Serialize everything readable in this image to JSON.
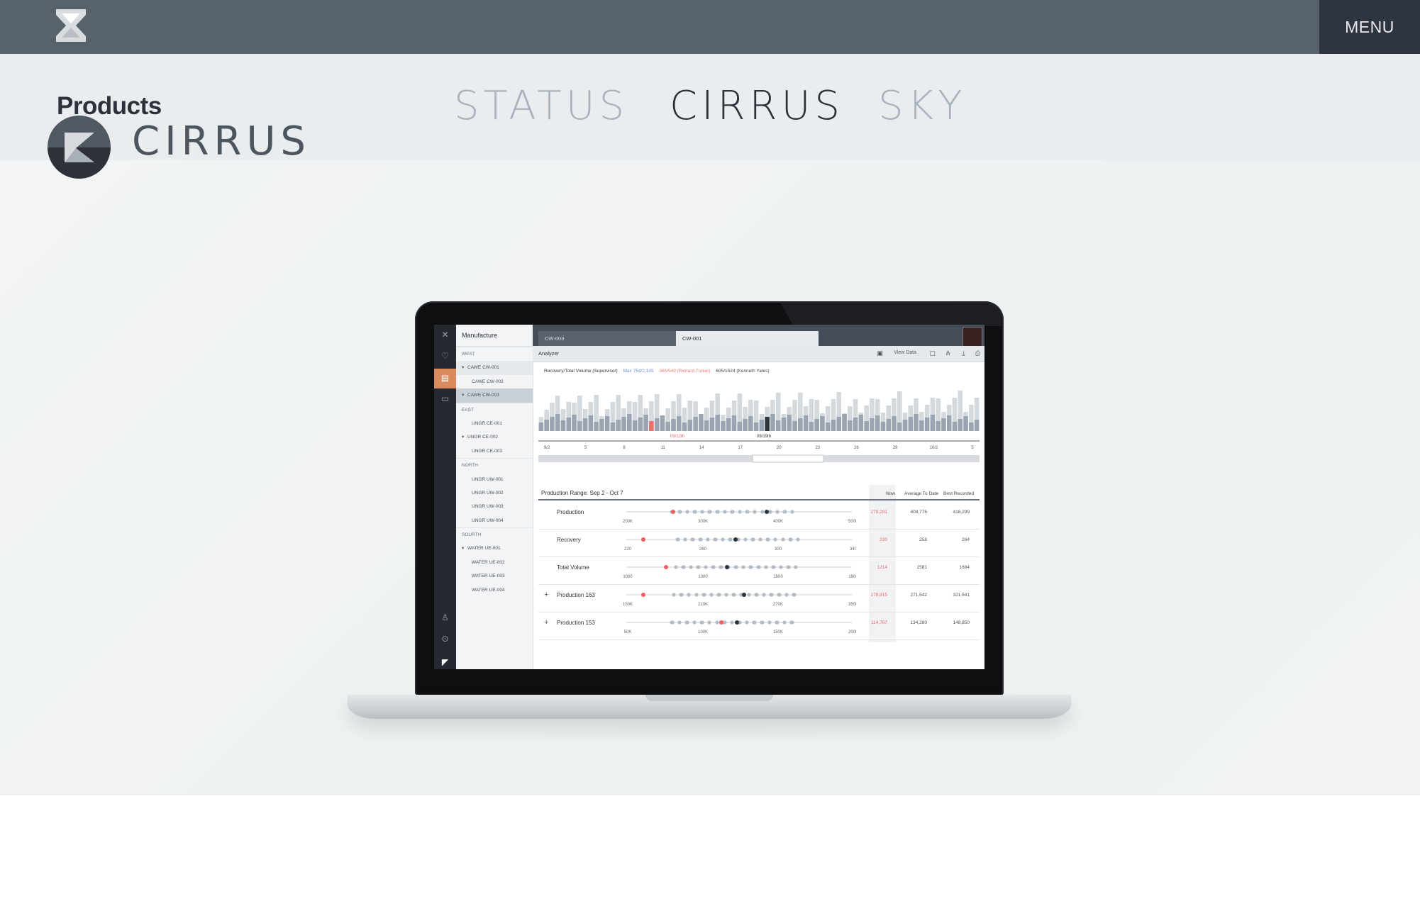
{
  "header": {
    "menu_label": "MENU",
    "logo_icon": "hourglass-logo-icon"
  },
  "nav": {
    "title": "Products",
    "tabs": [
      {
        "label": "STATUS",
        "active": false
      },
      {
        "label": "CIRRUS",
        "active": true
      },
      {
        "label": "SKY",
        "active": false
      }
    ]
  },
  "hero": {
    "brand_name": "CIRRUS",
    "brand_icon": "cirrus-k-badge-icon"
  },
  "app": {
    "sidebar_title": "Manufacture",
    "tree": [
      {
        "label": "WEST",
        "type": "group"
      },
      {
        "label": "CAWE CW-001",
        "type": "node",
        "state": "hl"
      },
      {
        "label": "CAWE CW-002",
        "type": "leaf"
      },
      {
        "label": "CAWE CW-003",
        "type": "node",
        "state": "sel"
      },
      {
        "label": "EAST",
        "type": "group"
      },
      {
        "label": "UNGR CE-001",
        "type": "leaf"
      },
      {
        "label": "UNGR CE-002",
        "type": "node"
      },
      {
        "label": "UNGR CE-003",
        "type": "leaf"
      },
      {
        "label": "NORTH",
        "type": "group"
      },
      {
        "label": "UNGR UW-001",
        "type": "leaf"
      },
      {
        "label": "UNGR UW-002",
        "type": "leaf"
      },
      {
        "label": "UNGR UW-003",
        "type": "leaf"
      },
      {
        "label": "UNGR UW-004",
        "type": "leaf"
      },
      {
        "label": "SOURTH",
        "type": "group"
      },
      {
        "label": "WATER UE-001",
        "type": "node"
      },
      {
        "label": "WATER UE-002",
        "type": "leaf"
      },
      {
        "label": "WATER UE-003",
        "type": "leaf"
      },
      {
        "label": "WATER UE-004",
        "type": "leaf"
      }
    ],
    "tabs": [
      "CW-003",
      "CW-001"
    ],
    "toolbar_title": "Analyzer",
    "view_data_label": "View Data",
    "chart_legend": {
      "main": "Recovery/Total Volume (Supervisor)",
      "max": "Max 754/2,145",
      "mid": "365/549 (Richard Turker)",
      "low": "605/1524 (Kenneth Yates)"
    },
    "chart_markers": [
      "09/12th",
      "09/19th"
    ],
    "chart_ticks": [
      "9/2",
      "5",
      "8",
      "11",
      "14",
      "17",
      "20",
      "23",
      "26",
      "29",
      "10/2",
      "5"
    ],
    "range_title": "Production Range: Sep 2 - Oct 7",
    "columns": [
      "Now",
      "Average To Date",
      "Best Recorded"
    ],
    "rows": [
      {
        "label": "Production",
        "expandable": false,
        "ticks": [
          "200K",
          "300K",
          "400K",
          "500K"
        ],
        "now": "279,291",
        "avg": "408,776",
        "best": "418,299"
      },
      {
        "label": "Recovery",
        "expandable": false,
        "ticks": [
          "220",
          "260",
          "300",
          "340"
        ],
        "now": "230",
        "avg": "258",
        "best": "264"
      },
      {
        "label": "Total Volume",
        "expandable": false,
        "ticks": [
          "1000",
          "1300",
          "1600",
          "1900"
        ],
        "now": "1214",
        "avg": "1581",
        "best": "1684"
      },
      {
        "label": "Production 163",
        "expandable": true,
        "ticks": [
          "150K",
          "210K",
          "270K",
          "350K"
        ],
        "now": "178,915",
        "avg": "271,542",
        "best": "321,541"
      },
      {
        "label": "Production 153",
        "expandable": true,
        "ticks": [
          "50K",
          "100K",
          "150K",
          "200K"
        ],
        "now": "114,767",
        "avg": "134,280",
        "best": "148,850"
      }
    ]
  },
  "colors": {
    "topbar": "#57626b",
    "menu_bg": "#2f3540",
    "nav_bg": "#e9edf0",
    "active_tab": "#2c323a",
    "inactive_tab": "#a9b2bc",
    "accent_orange": "#d98a5f",
    "alert_red": "#e46b6b"
  }
}
